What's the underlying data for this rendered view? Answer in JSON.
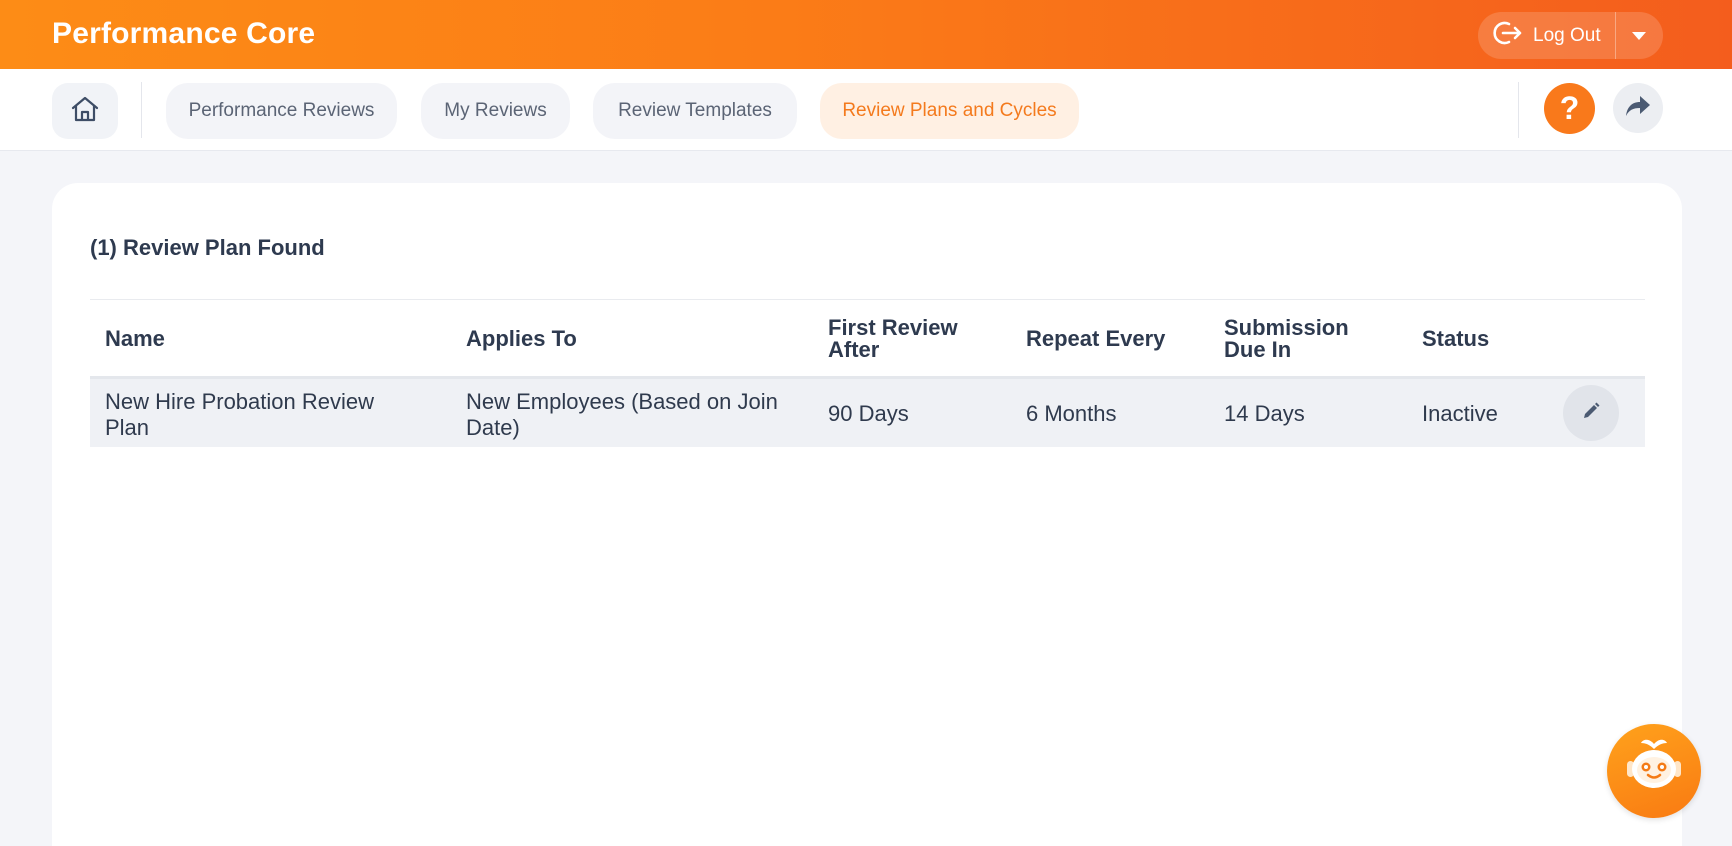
{
  "header": {
    "app_title": "Performance Core",
    "logout_label": "Log Out",
    "brand_color": "#fb7c17"
  },
  "nav": {
    "tabs": [
      {
        "label": "Performance Reviews",
        "active": false
      },
      {
        "label": "My Reviews",
        "active": false
      },
      {
        "label": "Review Templates",
        "active": false
      },
      {
        "label": "Review Plans and Cycles",
        "active": true
      }
    ],
    "help_glyph": "?",
    "icons": [
      "home-icon",
      "help-icon",
      "share-icon"
    ]
  },
  "main": {
    "results_heading": "(1) Review Plan Found",
    "table": {
      "columns": [
        {
          "line1": "Name",
          "line2": ""
        },
        {
          "line1": "Applies To",
          "line2": ""
        },
        {
          "line1": "First Review",
          "line2": "After"
        },
        {
          "line1": "Repeat Every",
          "line2": ""
        },
        {
          "line1": "Submission",
          "line2": "Due In"
        },
        {
          "line1": "Status",
          "line2": ""
        }
      ],
      "rows": [
        {
          "name_line1": "New Hire Probation Review",
          "name_line2": "Plan",
          "applies_line1": "New Employees (Based on Join",
          "applies_line2": "Date)",
          "first_review_after": "90 Days",
          "repeat_every": "6 Months",
          "submission_due_in": "14 Days",
          "status": "Inactive"
        }
      ]
    }
  },
  "assistant": {
    "icon": "robot-assistant-icon"
  }
}
